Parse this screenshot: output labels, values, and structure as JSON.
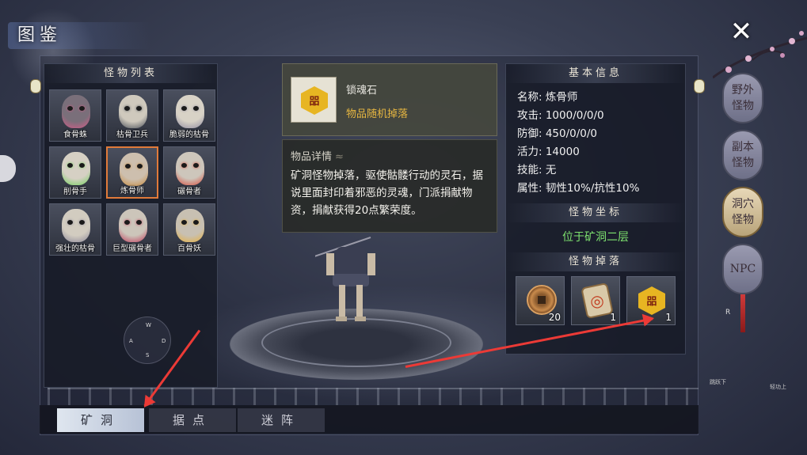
{
  "window": {
    "title": "图鉴",
    "close_label": "✕"
  },
  "monster_list": {
    "title": "怪物列表",
    "items": [
      {
        "name": "食骨蛛",
        "skin": "#7a6f7a",
        "accent": "#d85b8a"
      },
      {
        "name": "枯骨卫兵",
        "skin": "#cfc9bd",
        "accent": "#444a55"
      },
      {
        "name": "脆弱的枯骨",
        "skin": "#d8d2c6",
        "accent": "#8e8aa0"
      },
      {
        "name": "削骨手",
        "skin": "#d6d0c4",
        "accent": "#6fd15a"
      },
      {
        "name": "炼骨师",
        "skin": "#cdbfae",
        "accent": "#c88a3a",
        "selected": true
      },
      {
        "name": "碾骨者",
        "skin": "#cdc6bb",
        "accent": "#d84a3a"
      },
      {
        "name": "强壮的枯骨",
        "skin": "#d2ccc0",
        "accent": "#8a8698"
      },
      {
        "name": "巨型碾骨者",
        "skin": "#ccc5ba",
        "accent": "#c03a5a"
      },
      {
        "name": "百骨妖",
        "skin": "#c8c0b2",
        "accent": "#e8b03a"
      }
    ]
  },
  "joystick": {
    "w": "W",
    "a": "A",
    "s": "S",
    "d": "D"
  },
  "item_detail": {
    "icon_glyph": "㗊",
    "name": "锁魂石",
    "source": "物品随机掉落",
    "detail_title": "物品详情",
    "description": "矿洞怪物掉落，驱使骷髅行动的灵石，据说里面封印着邪恶的灵魂，门派捐献物资，捐献获得20点繁荣度。"
  },
  "basic_info": {
    "title": "基本信息",
    "rows": [
      "名称: 炼骨师",
      "攻击: 1000/0/0/0",
      "防御: 450/0/0/0",
      "活力: 14000",
      "技能: 无",
      "属性: 韧性10%/抗性10%"
    ]
  },
  "coordinates": {
    "title": "怪物坐标",
    "value": "位于矿洞二层"
  },
  "drops": {
    "title": "怪物掉落",
    "items": [
      {
        "icon": "coin-icon",
        "qty": "20"
      },
      {
        "icon": "scroll-icon",
        "qty": "1"
      },
      {
        "icon": "soul-stone-icon",
        "qty": "1",
        "glyph": "㗊"
      }
    ]
  },
  "side_tabs": [
    {
      "label": "野外怪物"
    },
    {
      "label": "副本怪物"
    },
    {
      "label": "洞穴怪物",
      "active": true
    },
    {
      "label": "NPC"
    }
  ],
  "bottom_tabs": [
    {
      "label": "矿洞",
      "active": true
    },
    {
      "label": "据点"
    },
    {
      "label": "迷阵"
    }
  ],
  "misc": {
    "r_label": "R",
    "left_hint": "跳跃下",
    "right_hint": "轻功上"
  },
  "colors": {
    "arrow": "#ec3a36",
    "selected_border": "#e07a3a",
    "coord_green": "#7ee36f",
    "gold": "#e6b640"
  }
}
